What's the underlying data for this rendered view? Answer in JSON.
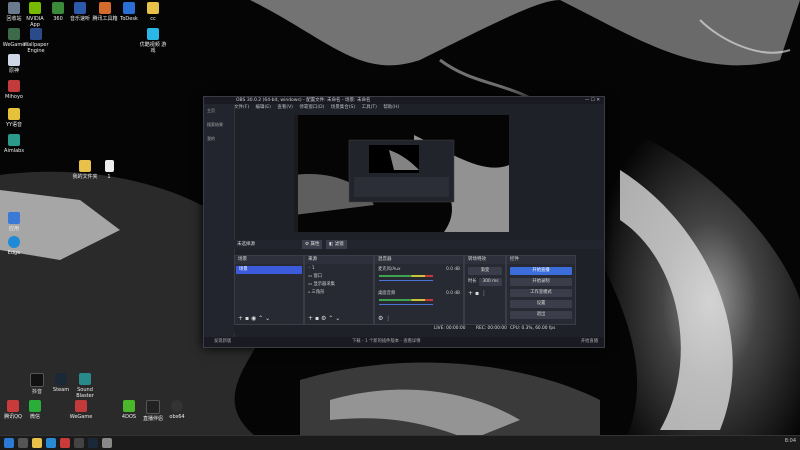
{
  "desktop_icons": [
    {
      "label": "回收站",
      "x": 0
    },
    {
      "label": "NVIDIA App",
      "x": 1
    },
    {
      "label": "360",
      "x": 2
    },
    {
      "label": "音乐速听",
      "x": 3
    },
    {
      "label": "腾讯工具箱",
      "x": 4
    },
    {
      "label": "ToDesk",
      "x": 5
    },
    {
      "label": "cc",
      "x": 6
    }
  ],
  "desktop_left": [
    "WeGame",
    "Wallpaper Engine",
    "原神",
    "Mihoyo",
    "YY语音",
    "Aimlabs",
    "",
    "",
    "应用",
    "Edge"
  ],
  "desktop_bottom": [
    "抖音",
    "Steam",
    "Sound Blaster",
    "腾讯QQ",
    "微信",
    "WeGame",
    "4DOS",
    "直播伴侣",
    "obs64"
  ],
  "desktop_misc": [
    "我的文件夹",
    "1",
    "优酷视频 游戏"
  ],
  "taskbar": {
    "time": "8:04"
  },
  "obs": {
    "title": "OBS 30.0.2 (64-bit, windows) - 配置文件: 未命名 - 场景: 未命名",
    "menu": [
      "文件(F)",
      "编辑(E)",
      "查看(V)",
      "停靠窗口(D)",
      "场景集合(S)",
      "工具(T)",
      "帮助(H)"
    ],
    "left": [
      "主页",
      "搜索结果",
      "我的"
    ],
    "bar": {
      "scene_label": "未选择源",
      "props": "属性",
      "filters": "滤镜"
    },
    "docks": {
      "scenes": "场景",
      "sources": "来源",
      "mixer": "混音器",
      "transitions": "转场特效",
      "controls": "控件"
    },
    "scene_items": [
      "场景"
    ],
    "source_items": [
      "1",
      "窗口",
      "显示器采集",
      "三角形"
    ],
    "mixer": [
      {
        "name": "桌面音频",
        "db": "0.0 dB"
      },
      {
        "name": "麦克风/Aux",
        "db": "0.0 dB"
      }
    ],
    "transitions": {
      "type": "渐变",
      "duration_label": "时长",
      "duration": "300 ms"
    },
    "controls": [
      "开始直播",
      "开始录制",
      "工作室模式",
      "设置",
      "退出"
    ],
    "status": {
      "live": "LIVE: 00:00:00",
      "rec": "REC: 00:00:00",
      "cpu": "CPU: 0.3%, 60.00 fps"
    },
    "bottom": [
      "发现新版",
      "下载 - 1 个新的插件版本 - 查看详情",
      "开始直播"
    ]
  }
}
